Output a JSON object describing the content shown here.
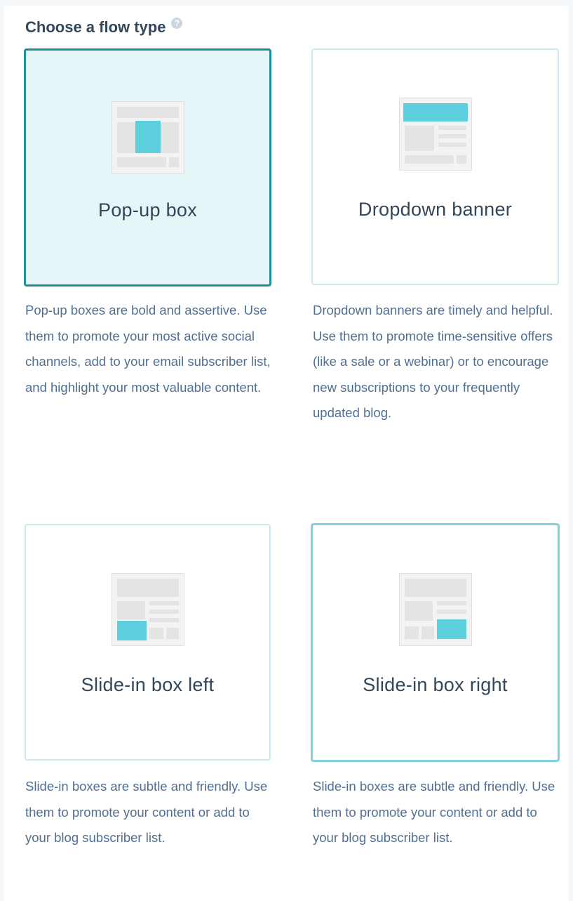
{
  "heading": {
    "title": "Choose a flow type",
    "help_icon": "?"
  },
  "colors": {
    "accent": "#5ecfdd",
    "selected_border": "#1f8e99",
    "selected_bg": "#e5f5f8",
    "thumb_bg": "#efefef"
  },
  "options": [
    {
      "label": "Pop-up box",
      "icon": "popup-box-icon",
      "selected": true,
      "description": "Pop-up boxes are bold and assertive. Use them to promote your most active social channels, add to your email subscriber list, and highlight your most valuable content."
    },
    {
      "label": "Dropdown banner",
      "icon": "dropdown-banner-icon",
      "selected": false,
      "description": "Dropdown banners are timely and helpful. Use them to promote time-sensitive offers (like a sale or a webinar) or to encourage new subscriptions to your frequently updated blog."
    },
    {
      "label": "Slide-in box left",
      "icon": "slide-in-left-icon",
      "selected": false,
      "description": "Slide-in boxes are subtle and friendly. Use them to promote your content or add to your blog subscriber list."
    },
    {
      "label": "Slide-in box right",
      "icon": "slide-in-right-icon",
      "selected": false,
      "description": "Slide-in boxes are subtle and friendly. Use them to promote your content or add to your blog subscriber list."
    }
  ]
}
